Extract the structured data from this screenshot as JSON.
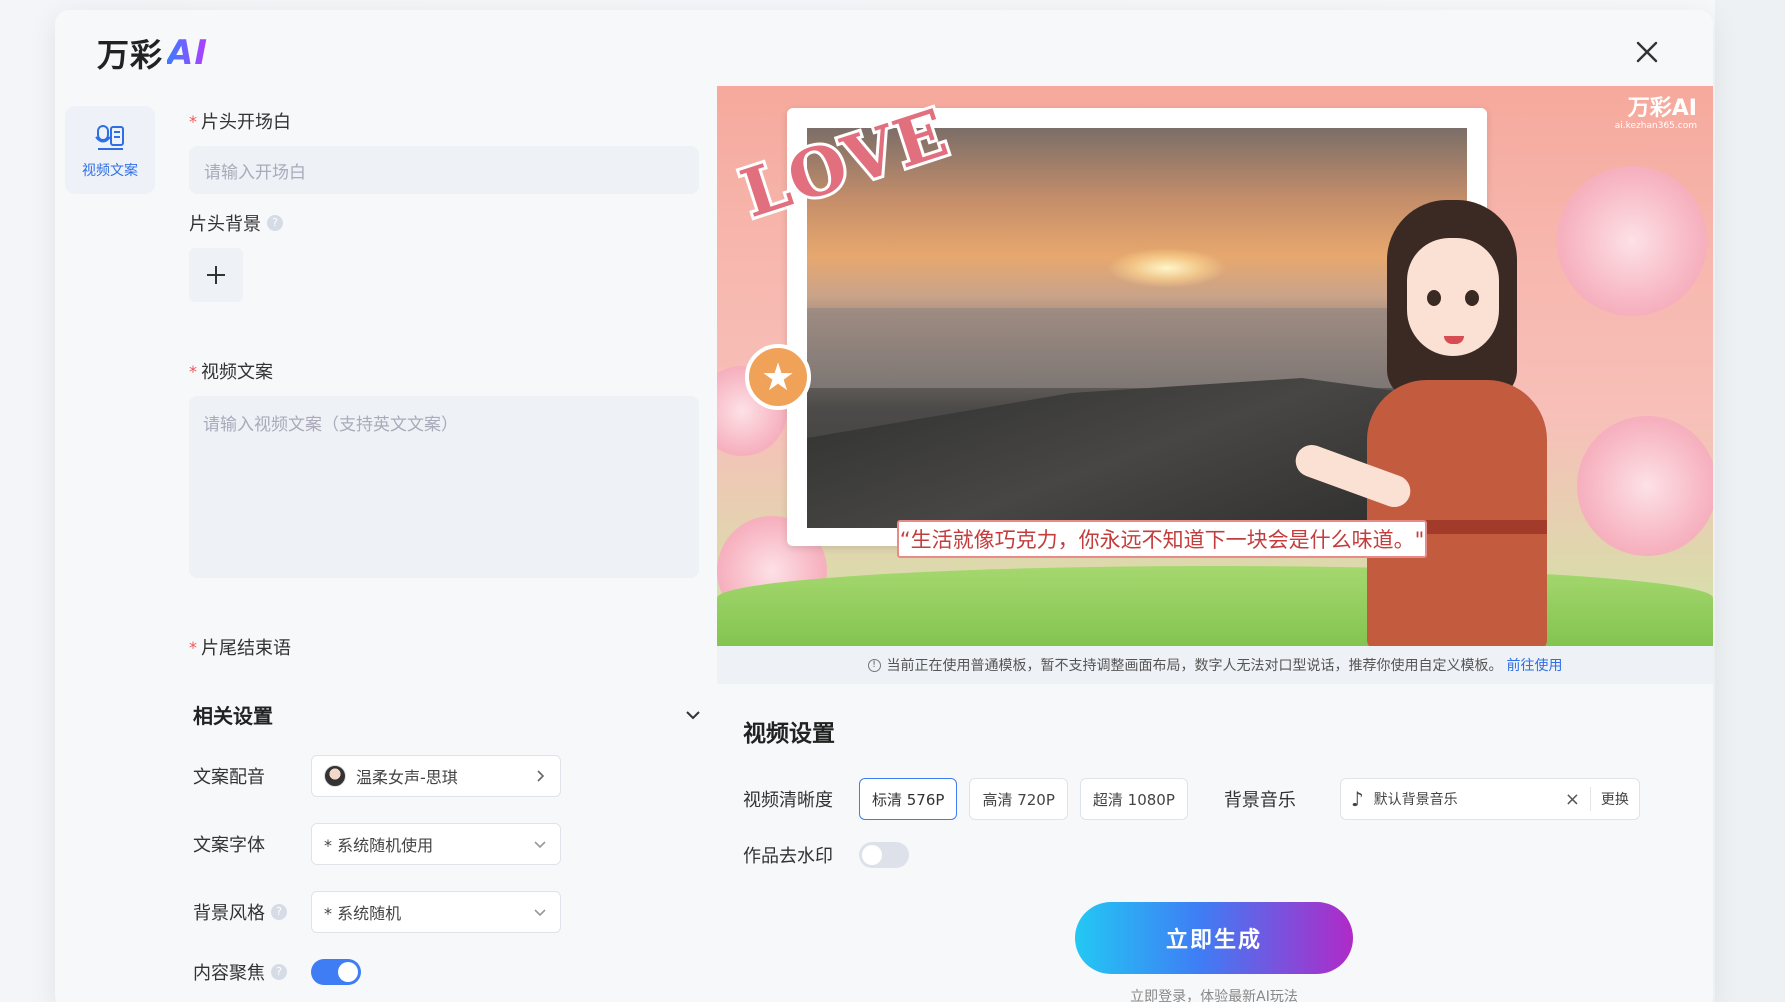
{
  "app": {
    "logo_text": "万彩",
    "logo_ai": "AI"
  },
  "side_nav": {
    "items": [
      {
        "label": "视频文案",
        "icon": "script-icon"
      }
    ]
  },
  "form": {
    "opening": {
      "label": "片头开场白",
      "placeholder": "请输入开场白"
    },
    "opening_bg": {
      "label": "片头背景"
    },
    "script": {
      "label": "视频文案",
      "placeholder": "请输入视频文案（支持英文文案）"
    },
    "ending": {
      "label": "片尾结束语"
    }
  },
  "related_settings": {
    "title": "相关设置",
    "voice": {
      "label": "文案配音",
      "value": "温柔女声-思琪"
    },
    "font": {
      "label": "文案字体",
      "value": "* 系统随机使用"
    },
    "bg_style": {
      "label": "背景风格",
      "value": "* 系统随机"
    },
    "focus": {
      "label": "内容聚焦",
      "enabled": true
    }
  },
  "preview": {
    "love_text": "LOVE",
    "watermark": "万彩AI",
    "watermark_url": "ai.kezhan365.com",
    "caption": "“生活就像巧克力，你永远不知道下一块会是什么味道。\""
  },
  "notice": {
    "text": "当前正在使用普通模板，暂不支持调整画面布局，数字人无法对口型说话，推荐你使用自定义模板。",
    "link": "前往使用"
  },
  "video_settings": {
    "title": "视频设置",
    "quality_label": "视频清晰度",
    "quality_options": [
      "标清 576P",
      "高清 720P",
      "超清 1080P"
    ],
    "quality_selected": "标清 576P",
    "music_label": "背景音乐",
    "music_value": "默认背景音乐",
    "music_change": "更换",
    "watermark_label": "作品去水印",
    "watermark_enabled": false
  },
  "generate": {
    "label": "立即生成",
    "sub": "立即登录，体验最新AI玩法"
  },
  "colors": {
    "accent": "#3f7df5",
    "required": "#e55555",
    "caption": "#c43d3d"
  }
}
